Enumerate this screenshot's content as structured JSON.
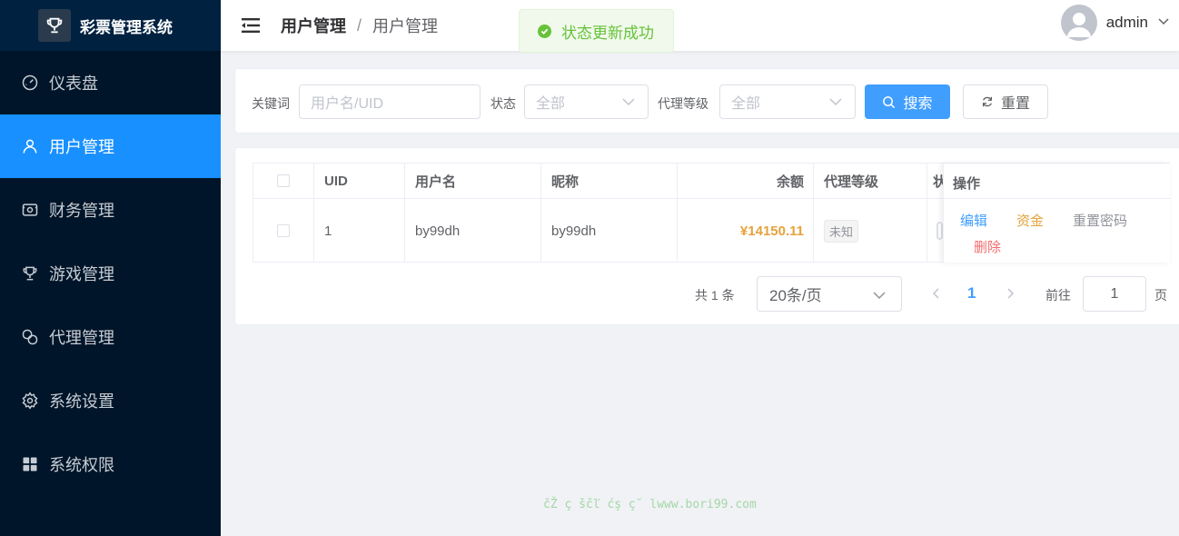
{
  "app": {
    "title": "彩票管理系统"
  },
  "sidebar": {
    "items": [
      {
        "label": "仪表盘",
        "icon": "dashboard-icon",
        "active": false
      },
      {
        "label": "用户管理",
        "icon": "user-icon",
        "active": true
      },
      {
        "label": "财务管理",
        "icon": "wallet-icon",
        "active": false
      },
      {
        "label": "游戏管理",
        "icon": "trophy-icon",
        "active": false
      },
      {
        "label": "代理管理",
        "icon": "link-icon",
        "active": false
      },
      {
        "label": "系统设置",
        "icon": "gear-icon",
        "active": false
      },
      {
        "label": "系统权限",
        "icon": "grid-icon",
        "active": false
      }
    ]
  },
  "header": {
    "breadcrumb": [
      "用户管理",
      "用户管理"
    ],
    "separator": "/",
    "username": "admin"
  },
  "toast": {
    "message": "状态更新成功",
    "type": "success",
    "color": "#67c23a"
  },
  "search": {
    "keyword_label": "关键词",
    "keyword_placeholder": "用户名/UID",
    "keyword_value": "",
    "status_label": "状态",
    "status_value": "全部",
    "agent_level_label": "代理等级",
    "agent_level_value": "全部",
    "search_button": "搜索",
    "reset_button": "重置"
  },
  "table": {
    "columns": [
      "UID",
      "用户名",
      "昵称",
      "余额",
      "代理等级",
      "状",
      "操作"
    ],
    "rows": [
      {
        "uid": "1",
        "username": "by99dh",
        "nickname": "by99dh",
        "balance": "¥14150.11",
        "agent_level": "未知"
      }
    ],
    "actions": [
      "编辑",
      "资金",
      "重置密码",
      "删除"
    ]
  },
  "pagination": {
    "total_text": "共 1 条",
    "page_size": "20条/页",
    "current_page": "1",
    "goto_label": "前往",
    "goto_value": "1",
    "goto_suffix": "页"
  },
  "footer": {
    "text": "čŽ ç ščľ ćş ç˘ lwww.bori99.com"
  },
  "colors": {
    "sidebar_bg": "#001529",
    "active": "#1890ff",
    "primary": "#409eff",
    "warning": "#e6a23c",
    "danger": "#f56c6c",
    "success": "#67c23a"
  }
}
